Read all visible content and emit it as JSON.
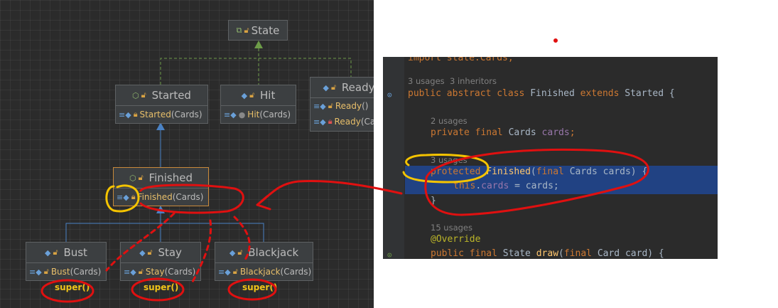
{
  "diagram": {
    "nodes": {
      "state": {
        "title": "State"
      },
      "started": {
        "title": "Started",
        "members": [
          {
            "name": "Started",
            "args": "(Cards)"
          }
        ]
      },
      "hit": {
        "title": "Hit",
        "members": [
          {
            "name": "Hit",
            "args": "(Cards)"
          }
        ]
      },
      "ready": {
        "title": "Ready",
        "members": [
          {
            "name": "Ready",
            "args": "()"
          },
          {
            "name": "Ready",
            "args": "(Ca"
          }
        ]
      },
      "finished": {
        "title": "Finished",
        "members": [
          {
            "name": "Finished",
            "args": "(Cards)"
          }
        ]
      },
      "bust": {
        "title": "Bust",
        "members": [
          {
            "name": "Bust",
            "args": "(Cards)"
          }
        ]
      },
      "stay": {
        "title": "Stay",
        "members": [
          {
            "name": "Stay",
            "args": "(Cards)"
          }
        ]
      },
      "blackjack": {
        "title": "Blackjack",
        "members": [
          {
            "name": "Blackjack",
            "args": "(Cards)"
          }
        ]
      }
    },
    "super_labels": [
      "super()",
      "super()",
      "super()"
    ]
  },
  "code": {
    "line0": "import state.Cards;",
    "hint1": "3 usages  3 inheritors",
    "line1_kw": "public abstract class ",
    "line1_name": "Finished",
    "line1_ext": " extends ",
    "line1_parent": "Started",
    "line1_brace": " {",
    "hint2": "2 usages",
    "line2_kw": "private final ",
    "line2_type": "Cards ",
    "line2_field": "cards",
    "line2_end": ";",
    "hint3": "3 usages",
    "line3_kw": "protected ",
    "line3_name": "Finished",
    "line3_p1": "(",
    "line3_final": "final ",
    "line3_rest": "Cards cards) {",
    "line4_kw": "this",
    "line4_dot": ".",
    "line4_field": "cards",
    "line4_rest": " = cards;",
    "line5": "}",
    "hint4": "15 usages",
    "line6": "@Override",
    "line7_kw": "public final ",
    "line7_type": "State ",
    "line7_fn": "draw",
    "line7_p": "(",
    "line7_final": "final ",
    "line7_rest": "Card card) {"
  },
  "colors": {
    "annotation_red": "#e01010",
    "annotation_yellow": "#f5c400",
    "selection": "#214283"
  }
}
